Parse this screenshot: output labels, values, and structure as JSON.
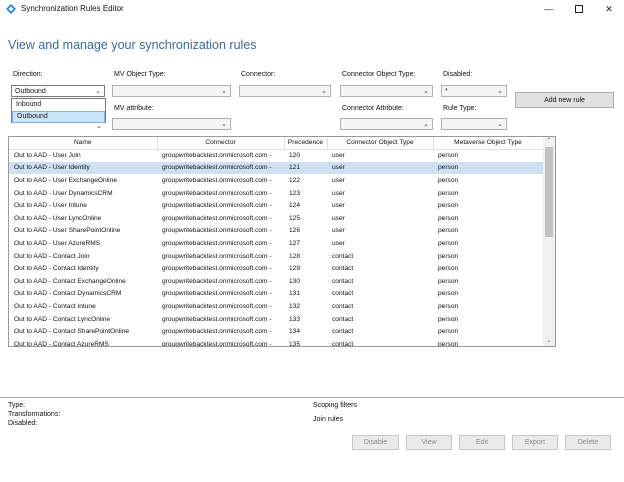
{
  "window": {
    "title": "Synchronization Rules Editor",
    "minimize_icon": "minimize-icon",
    "maximize_icon": "maximize-icon",
    "close_icon": "close-icon"
  },
  "heading": "View and manage your synchronization rules",
  "filters": {
    "direction": {
      "label": "Direction:",
      "value": "Outbound",
      "options": [
        "Inbound",
        "Outbound"
      ]
    },
    "mv_object_type": {
      "label": "MV Object Type:",
      "value": ""
    },
    "connector": {
      "label": "Connector:",
      "value": ""
    },
    "connector_object_type": {
      "label": "Connector Object Type:",
      "value": ""
    },
    "disabled": {
      "label": "Disabled:",
      "value": "*"
    },
    "mv_attribute": {
      "label": "MV attribute:",
      "value": ""
    },
    "connector_attribute": {
      "label": "Connector Attribute:",
      "value": ""
    },
    "rule_type": {
      "label": "Rule Type:",
      "value": ""
    }
  },
  "add_new_rule_label": "Add new rule",
  "table": {
    "columns": [
      "Name",
      "Connector",
      "Precedence",
      "Connector Object Type",
      "Metaverse Object Type"
    ],
    "rows": [
      {
        "name": "Out to AAD - User Join",
        "connector": "groupwritebacktest.onmicrosoft.com -",
        "precedence": "120",
        "cot": "user",
        "mot": "person"
      },
      {
        "name": "Out to AAD - User Identity",
        "connector": "groupwritebacktest.onmicrosoft.com -",
        "precedence": "121",
        "cot": "user",
        "mot": "person"
      },
      {
        "name": "Out to AAD - User ExchangeOnline",
        "connector": "groupwritebacktest.onmicrosoft.com -",
        "precedence": "122",
        "cot": "user",
        "mot": "person"
      },
      {
        "name": "Out to AAD - User DynamicsCRM",
        "connector": "groupwritebacktest.onmicrosoft.com -",
        "precedence": "123",
        "cot": "user",
        "mot": "person"
      },
      {
        "name": "Out to AAD - User Intune",
        "connector": "groupwritebacktest.onmicrosoft.com -",
        "precedence": "124",
        "cot": "user",
        "mot": "person"
      },
      {
        "name": "Out to AAD - User LyncOnline",
        "connector": "groupwritebacktest.onmicrosoft.com -",
        "precedence": "125",
        "cot": "user",
        "mot": "person"
      },
      {
        "name": "Out to AAD - User SharePointOnline",
        "connector": "groupwritebacktest.onmicrosoft.com -",
        "precedence": "126",
        "cot": "user",
        "mot": "person"
      },
      {
        "name": "Out to AAD - User AzureRMS",
        "connector": "groupwritebacktest.onmicrosoft.com -",
        "precedence": "127",
        "cot": "user",
        "mot": "person"
      },
      {
        "name": "Out to AAD - Contact Join",
        "connector": "groupwritebacktest.onmicrosoft.com -",
        "precedence": "128",
        "cot": "contact",
        "mot": "person"
      },
      {
        "name": "Out to AAD - Contact Identity",
        "connector": "groupwritebacktest.onmicrosoft.com -",
        "precedence": "129",
        "cot": "contact",
        "mot": "person"
      },
      {
        "name": "Out to AAD - Contact ExchangeOnline",
        "connector": "groupwritebacktest.onmicrosoft.com -",
        "precedence": "130",
        "cot": "contact",
        "mot": "person"
      },
      {
        "name": "Out to AAD - Contact DynamicsCRM",
        "connector": "groupwritebacktest.onmicrosoft.com -",
        "precedence": "131",
        "cot": "contact",
        "mot": "person"
      },
      {
        "name": "Out to AAD - Contact Intune",
        "connector": "groupwritebacktest.onmicrosoft.com -",
        "precedence": "132",
        "cot": "contact",
        "mot": "person"
      },
      {
        "name": "Out to AAD - Contact LyncOnline",
        "connector": "groupwritebacktest.onmicrosoft.com -",
        "precedence": "133",
        "cot": "contact",
        "mot": "person"
      },
      {
        "name": "Out to AAD - Contact SharePointOnline",
        "connector": "groupwritebacktest.onmicrosoft.com -",
        "precedence": "134",
        "cot": "contact",
        "mot": "person"
      },
      {
        "name": "Out to AAD - Contact AzureRMS",
        "connector": "groupwritebacktest.onmicrosoft.com -",
        "precedence": "135",
        "cot": "contact",
        "mot": "person"
      }
    ],
    "selected_row": "Out to AAD - User Identity"
  },
  "details": {
    "type_label": "Type:",
    "transformations_label": "Transformations:",
    "disabled_label": "Disabled:",
    "scoping_filters_label": "Scoping filters",
    "join_rules_label": "Join rules"
  },
  "actions": {
    "disable": "Disable",
    "view": "View",
    "edit": "Edit",
    "export": "Export",
    "delete": "Delete"
  },
  "colors": {
    "heading": "#3b6a96",
    "selection": "#cde1f3",
    "accent_icon": "#1e88d4"
  }
}
